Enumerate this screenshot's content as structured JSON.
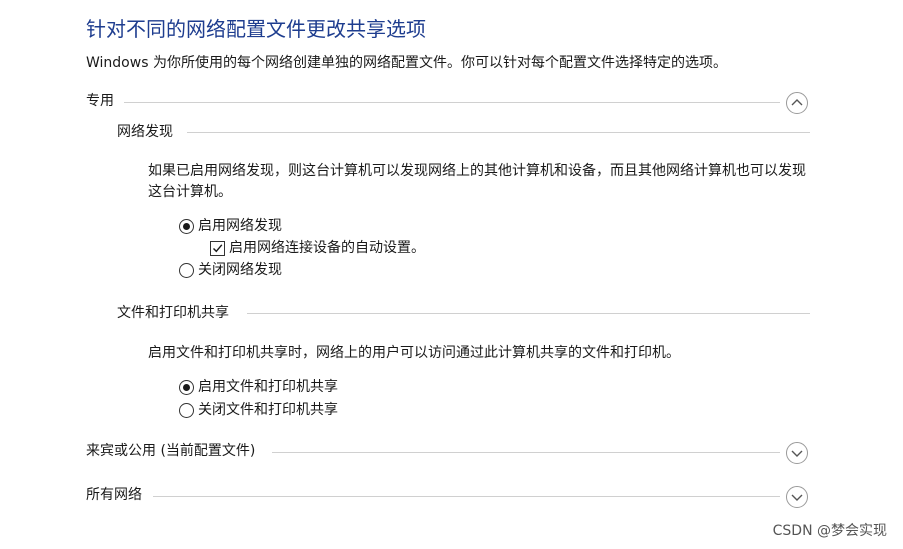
{
  "page": {
    "title": "针对不同的网络配置文件更改共享选项",
    "description": "Windows 为你所使用的每个网络创建单独的网络配置文件。你可以针对每个配置文件选择特定的选项。"
  },
  "profiles": {
    "private": {
      "label": "专用",
      "expanded": true,
      "network_discovery": {
        "heading": "网络发现",
        "description": "如果已启用网络发现，则这台计算机可以发现网络上的其他计算机和设备，而且其他网络计算机也可以发现这台计算机。",
        "enable_label": "启用网络发现",
        "auto_setup_label": "启用网络连接设备的自动设置。",
        "disable_label": "关闭网络发现",
        "selected": "enable",
        "auto_setup_checked": true
      },
      "file_printer_sharing": {
        "heading": "文件和打印机共享",
        "description": "启用文件和打印机共享时，网络上的用户可以访问通过此计算机共享的文件和打印机。",
        "enable_label": "启用文件和打印机共享",
        "disable_label": "关闭文件和打印机共享",
        "selected": "enable"
      }
    },
    "guest_public": {
      "label": "来宾或公用 (当前配置文件)",
      "expanded": false
    },
    "all_networks": {
      "label": "所有网络",
      "expanded": false
    }
  },
  "watermark": "CSDN @梦会实现",
  "icons": {
    "expanded": "chevron-up-icon",
    "collapsed": "chevron-down-icon",
    "checkmark": "checkmark-icon"
  },
  "colors": {
    "title": "#1e3d8f",
    "divider": "#d0d0d0",
    "text": "#1a1a1a"
  }
}
